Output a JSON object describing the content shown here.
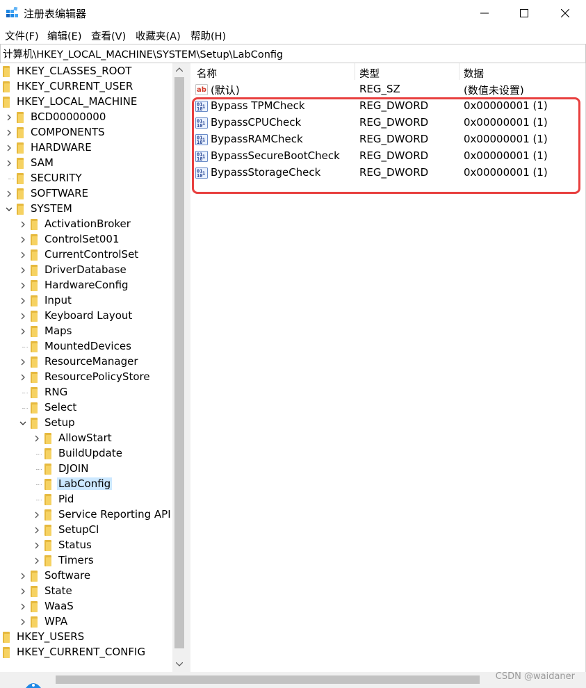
{
  "window": {
    "title": "注册表编辑器"
  },
  "menu": [
    "文件(F)",
    "编辑(E)",
    "查看(V)",
    "收藏夹(A)",
    "帮助(H)"
  ],
  "address": "计算机\\HKEY_LOCAL_MACHINE\\SYSTEM\\Setup\\LabConfig",
  "tree": [
    {
      "label": "HKEY_CLASSES_ROOT",
      "level": 0,
      "expander": "none"
    },
    {
      "label": "HKEY_CURRENT_USER",
      "level": 0,
      "expander": "none"
    },
    {
      "label": "HKEY_LOCAL_MACHINE",
      "level": 0,
      "expander": "none"
    },
    {
      "label": "BCD00000000",
      "level": 1,
      "expander": "collapsed"
    },
    {
      "label": "COMPONENTS",
      "level": 1,
      "expander": "collapsed"
    },
    {
      "label": "HARDWARE",
      "level": 1,
      "expander": "collapsed"
    },
    {
      "label": "SAM",
      "level": 1,
      "expander": "collapsed"
    },
    {
      "label": "SECURITY",
      "level": 1,
      "expander": "none"
    },
    {
      "label": "SOFTWARE",
      "level": 1,
      "expander": "collapsed"
    },
    {
      "label": "SYSTEM",
      "level": 1,
      "expander": "expanded"
    },
    {
      "label": "ActivationBroker",
      "level": 2,
      "expander": "collapsed"
    },
    {
      "label": "ControlSet001",
      "level": 2,
      "expander": "collapsed"
    },
    {
      "label": "CurrentControlSet",
      "level": 2,
      "expander": "collapsed"
    },
    {
      "label": "DriverDatabase",
      "level": 2,
      "expander": "collapsed"
    },
    {
      "label": "HardwareConfig",
      "level": 2,
      "expander": "collapsed"
    },
    {
      "label": "Input",
      "level": 2,
      "expander": "collapsed"
    },
    {
      "label": "Keyboard Layout",
      "level": 2,
      "expander": "collapsed"
    },
    {
      "label": "Maps",
      "level": 2,
      "expander": "collapsed"
    },
    {
      "label": "MountedDevices",
      "level": 2,
      "expander": "none"
    },
    {
      "label": "ResourceManager",
      "level": 2,
      "expander": "collapsed"
    },
    {
      "label": "ResourcePolicyStore",
      "level": 2,
      "expander": "collapsed"
    },
    {
      "label": "RNG",
      "level": 2,
      "expander": "none"
    },
    {
      "label": "Select",
      "level": 2,
      "expander": "none"
    },
    {
      "label": "Setup",
      "level": 2,
      "expander": "expanded"
    },
    {
      "label": "AllowStart",
      "level": 3,
      "expander": "collapsed"
    },
    {
      "label": "BuildUpdate",
      "level": 3,
      "expander": "none"
    },
    {
      "label": "DJOIN",
      "level": 3,
      "expander": "none"
    },
    {
      "label": "LabConfig",
      "level": 3,
      "expander": "none",
      "selected": true
    },
    {
      "label": "Pid",
      "level": 3,
      "expander": "none"
    },
    {
      "label": "Service Reporting API",
      "level": 3,
      "expander": "collapsed"
    },
    {
      "label": "SetupCl",
      "level": 3,
      "expander": "collapsed"
    },
    {
      "label": "Status",
      "level": 3,
      "expander": "collapsed"
    },
    {
      "label": "Timers",
      "level": 3,
      "expander": "collapsed"
    },
    {
      "label": "Software",
      "level": 2,
      "expander": "collapsed"
    },
    {
      "label": "State",
      "level": 2,
      "expander": "collapsed"
    },
    {
      "label": "WaaS",
      "level": 2,
      "expander": "collapsed"
    },
    {
      "label": "WPA",
      "level": 2,
      "expander": "collapsed"
    },
    {
      "label": "HKEY_USERS",
      "level": 0,
      "expander": "none"
    },
    {
      "label": "HKEY_CURRENT_CONFIG",
      "level": 0,
      "expander": "none"
    }
  ],
  "list": {
    "headers": {
      "name": "名称",
      "type": "类型",
      "data": "数据"
    },
    "rows": [
      {
        "name": "(默认)",
        "type": "REG_SZ",
        "data": "(数值未设置)",
        "icon": "string-value-icon"
      },
      {
        "name": "Bypass TPMCheck",
        "type": "REG_DWORD",
        "data": "0x00000001 (1)",
        "icon": "binary-value-icon"
      },
      {
        "name": "BypassCPUCheck",
        "type": "REG_DWORD",
        "data": "0x00000001 (1)",
        "icon": "binary-value-icon"
      },
      {
        "name": "BypassRAMCheck",
        "type": "REG_DWORD",
        "data": "0x00000001 (1)",
        "icon": "binary-value-icon"
      },
      {
        "name": "BypassSecureBootCheck",
        "type": "REG_DWORD",
        "data": "0x00000001 (1)",
        "icon": "binary-value-icon"
      },
      {
        "name": "BypassStorageCheck",
        "type": "REG_DWORD",
        "data": "0x00000001 (1)",
        "icon": "binary-value-icon"
      }
    ]
  },
  "watermark": "CSDN @waidaner",
  "colors": {
    "highlight_box": "#e8403f",
    "selection": "#cce8ff",
    "folder": "#f6d262"
  }
}
